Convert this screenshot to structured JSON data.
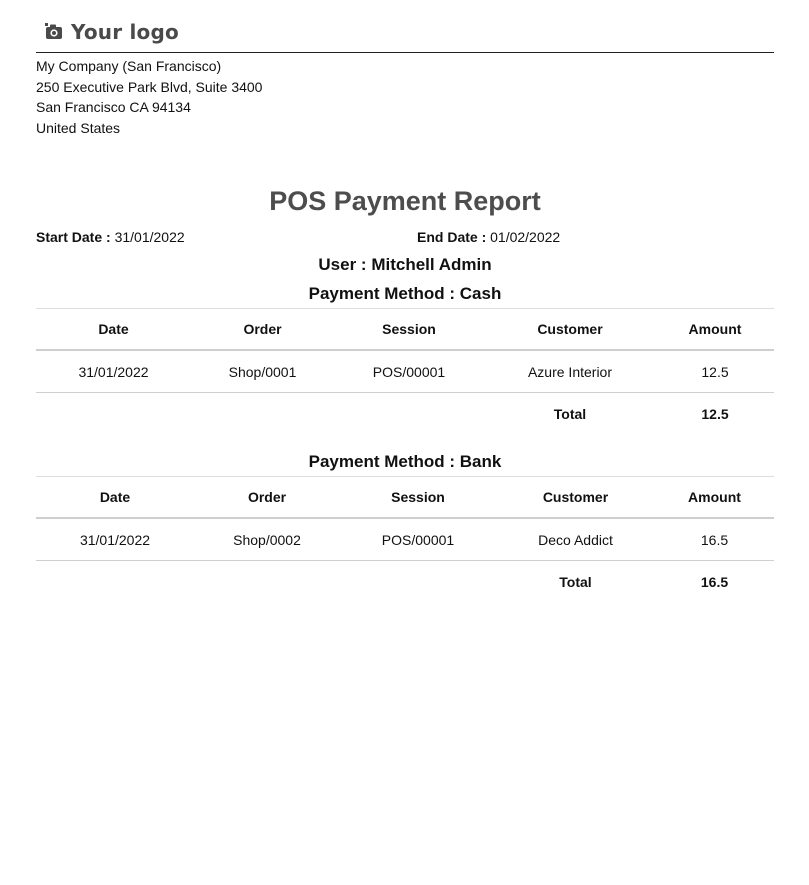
{
  "header": {
    "logo_text": "Your logo",
    "logo_icon": "camera-icon"
  },
  "company": {
    "name": "My Company (San Francisco)",
    "street": "250 Executive Park Blvd, Suite 3400",
    "city_line": "San Francisco CA 94134",
    "country": "United States"
  },
  "report": {
    "title": "POS Payment Report",
    "start_label": "Start Date :",
    "start_value": "31/01/2022",
    "end_label": "End Date :",
    "end_value": "01/02/2022",
    "user_line": "User : Mitchell Admin"
  },
  "columns": [
    "Date",
    "Order",
    "Session",
    "Customer",
    "Amount"
  ],
  "methods": [
    {
      "title": "Payment Method : Cash",
      "rows": [
        {
          "date": "31/01/2022",
          "order": "Shop/0001",
          "session": "POS/00001",
          "customer": "Azure Interior",
          "amount": "12.5"
        }
      ],
      "total_label": "Total",
      "total_value": "12.5"
    },
    {
      "title": "Payment Method : Bank",
      "rows": [
        {
          "date": "31/01/2022",
          "order": "Shop/0002",
          "session": "POS/00001",
          "customer": "Deco Addict",
          "amount": "16.5"
        }
      ],
      "total_label": "Total",
      "total_value": "16.5"
    }
  ]
}
